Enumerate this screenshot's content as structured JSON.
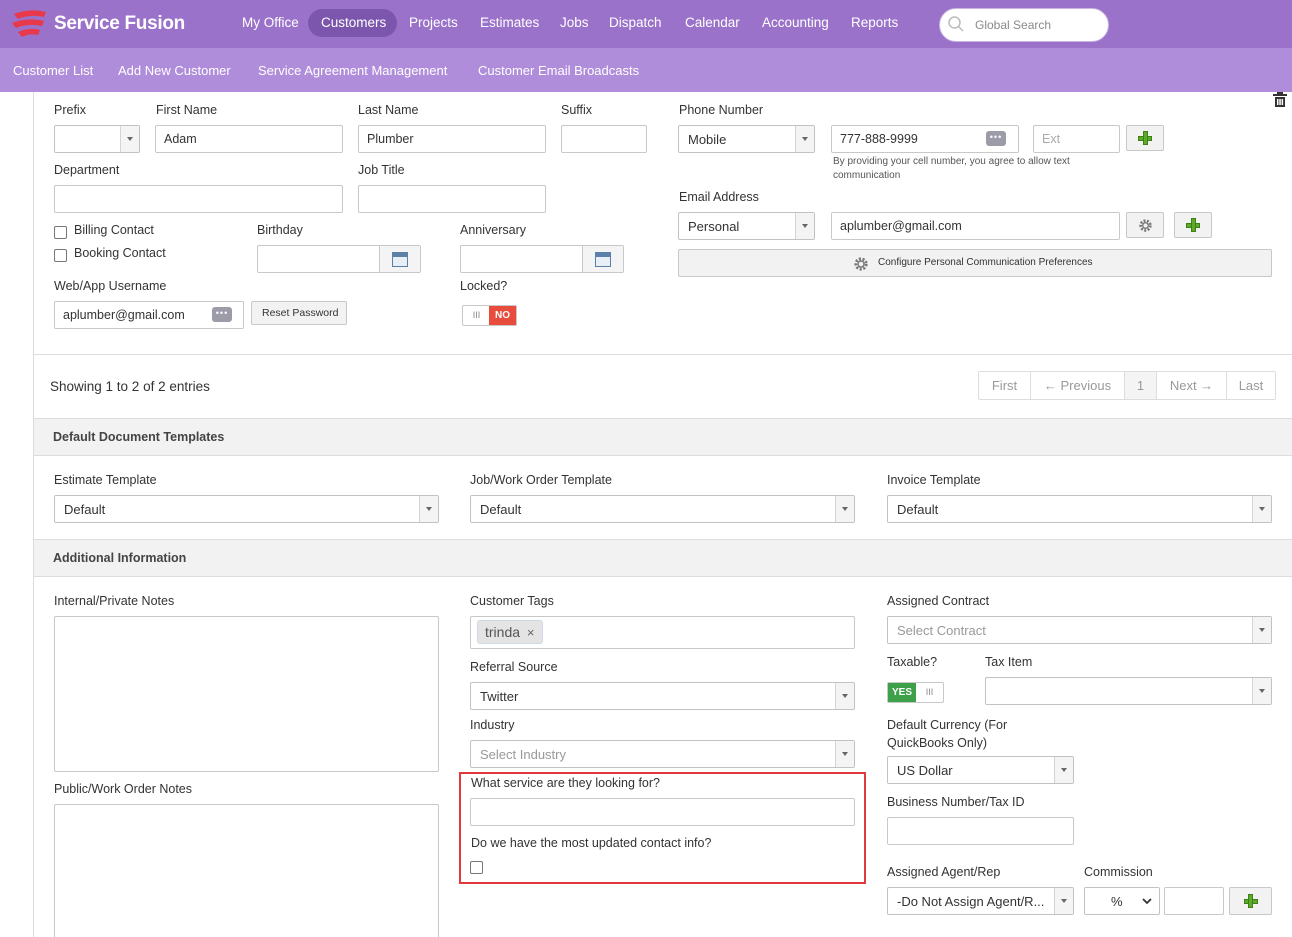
{
  "brand": {
    "name": "Service Fusion"
  },
  "nav": {
    "items": [
      "My Office",
      "Customers",
      "Projects",
      "Estimates",
      "Jobs",
      "Dispatch",
      "Calendar",
      "Accounting",
      "Reports"
    ],
    "active": "Customers",
    "search_placeholder": "Global Search"
  },
  "subnav": {
    "items": [
      "Customer List",
      "Add New Customer",
      "Service Agreement Management",
      "Customer Email Broadcasts"
    ]
  },
  "contact": {
    "prefix_label": "Prefix",
    "prefix_value": "",
    "first_name_label": "First Name",
    "first_name": "Adam",
    "last_name_label": "Last Name",
    "last_name": "Plumber",
    "suffix_label": "Suffix",
    "suffix": "",
    "department_label": "Department",
    "department": "",
    "job_title_label": "Job Title",
    "job_title": "",
    "billing_contact_label": "Billing Contact",
    "booking_contact_label": "Booking Contact",
    "birthday_label": "Birthday",
    "anniversary_label": "Anniversary",
    "web_username_label": "Web/App Username",
    "web_username": "aplumber@gmail.com",
    "reset_password_label": "Reset Password",
    "locked_label": "Locked?",
    "locked_state": "NO",
    "phone_label": "Phone Number",
    "phone_type": "Mobile",
    "phone_number": "777-888-9999",
    "phone_ext_placeholder": "Ext",
    "phone_disclaimer": "By providing your cell number, you agree to allow text communication",
    "email_label": "Email Address",
    "email_type": "Personal",
    "email": "aplumber@gmail.com",
    "configure_prefs_label": "Configure Personal Communication Preferences"
  },
  "pagination": {
    "showing": "Showing 1 to 2 of 2 entries",
    "first": "First",
    "previous": "← Previous",
    "page": "1",
    "next": "Next →",
    "last": "Last"
  },
  "templates": {
    "title": "Default Document Templates",
    "estimate_label": "Estimate Template",
    "estimate_value": "Default",
    "job_label": "Job/Work Order Template",
    "job_value": "Default",
    "invoice_label": "Invoice Template",
    "invoice_value": "Default"
  },
  "additional": {
    "title": "Additional Information",
    "internal_notes_label": "Internal/Private Notes",
    "public_notes_label": "Public/Work Order Notes",
    "tags_label": "Customer Tags",
    "tag": "trinda",
    "referral_label": "Referral Source",
    "referral_value": "Twitter",
    "industry_label": "Industry",
    "industry_placeholder": "Select Industry",
    "service_question": "What service are they looking for?",
    "service_answer": "",
    "contact_info_question": "Do we have the most updated contact info?",
    "assigned_contract_label": "Assigned Contract",
    "assigned_contract_placeholder": "Select Contract",
    "taxable_label": "Taxable?",
    "taxable_state": "YES",
    "tax_item_label": "Tax Item",
    "tax_item_value": "",
    "currency_label": "Default Currency (For QuickBooks Only)",
    "currency_value": "US Dollar",
    "business_number_label": "Business Number/Tax ID",
    "business_number": "",
    "agent_label": "Assigned Agent/Rep",
    "agent_value": "-Do Not Assign Agent/R...",
    "commission_label": "Commission",
    "commission_unit": "%",
    "commission_value": ""
  },
  "colors": {
    "nav": "#9a72c9",
    "subnav": "#b08ddb",
    "active_pill": "#7c56ad",
    "no": "#e84c3d",
    "yes": "#3ea14a",
    "highlight": "#e0393e"
  }
}
